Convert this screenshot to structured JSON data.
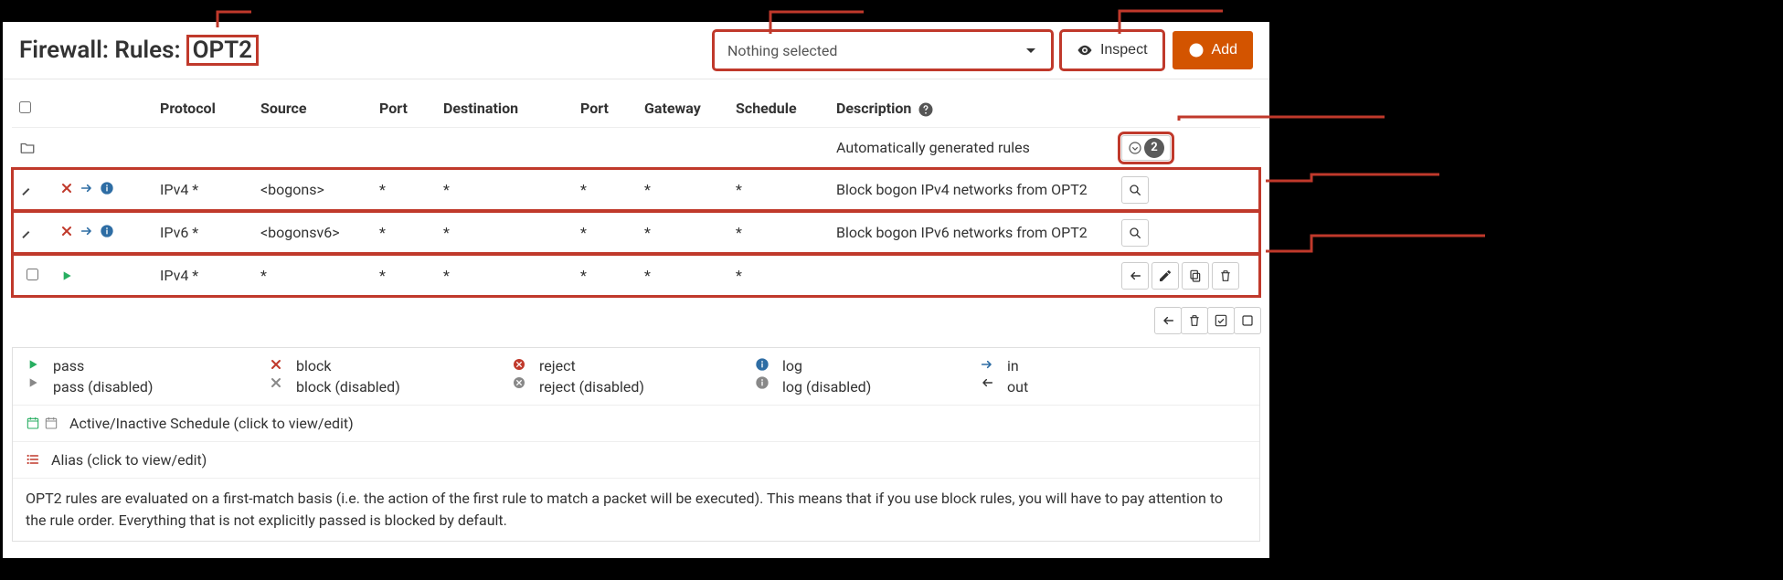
{
  "header": {
    "title_prefix": "Firewall: Rules:",
    "interface": "OPT2",
    "select_placeholder": "Nothing selected",
    "inspect_label": "Inspect",
    "add_label": "Add"
  },
  "columns": {
    "protocol": "Protocol",
    "source": "Source",
    "port1": "Port",
    "destination": "Destination",
    "port2": "Port",
    "gateway": "Gateway",
    "schedule": "Schedule",
    "description": "Description"
  },
  "auto_row": {
    "description": "Automatically generated rules",
    "count": "2"
  },
  "rows": [
    {
      "protocol": "IPv4 *",
      "source": "<bogons>",
      "port1": "*",
      "destination": "*",
      "port2": "*",
      "gateway": "*",
      "schedule": "*",
      "description": "Block bogon IPv4 networks from OPT2"
    },
    {
      "protocol": "IPv6 *",
      "source": "<bogonsv6>",
      "port1": "*",
      "destination": "*",
      "port2": "*",
      "gateway": "*",
      "schedule": "*",
      "description": "Block bogon IPv6 networks from OPT2"
    },
    {
      "protocol": "IPv4 *",
      "source": "*",
      "port1": "*",
      "destination": "*",
      "port2": "*",
      "gateway": "*",
      "schedule": "*",
      "description": ""
    }
  ],
  "legend": {
    "pass": "pass",
    "pass_disabled": "pass (disabled)",
    "block": "block",
    "block_disabled": "block (disabled)",
    "reject": "reject",
    "reject_disabled": "reject (disabled)",
    "log": "log",
    "log_disabled": "log (disabled)",
    "in": "in",
    "out": "out",
    "schedule": "Active/Inactive Schedule (click to view/edit)",
    "alias": "Alias (click to view/edit)",
    "note": "OPT2 rules are evaluated on a first-match basis (i.e. the action of the first rule to match a packet will be executed). This means that if you use block rules, you will have to pay attention to the rule order. Everything that is not explicitly passed is blocked by default."
  }
}
